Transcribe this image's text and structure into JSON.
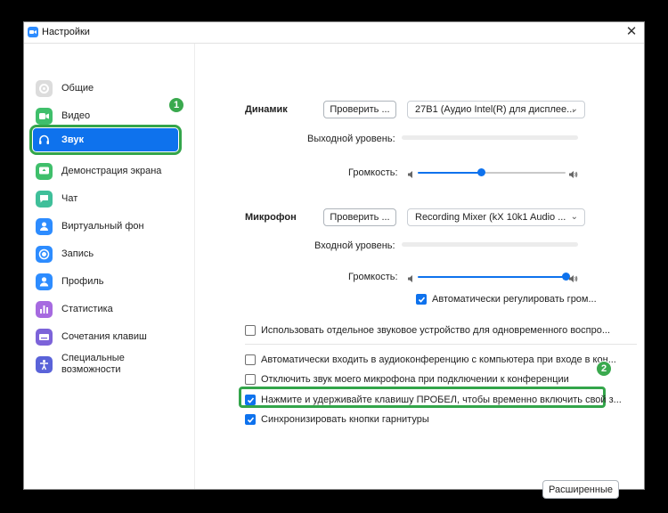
{
  "window": {
    "title": "Настройки",
    "close": "✕"
  },
  "sidebar": {
    "items": [
      {
        "label": "Общие",
        "icon": "gear-icon",
        "color": "#dcdcdc"
      },
      {
        "label": "Видео",
        "icon": "video-icon",
        "color": "#3fbf6b"
      },
      {
        "label": "Звук",
        "icon": "headphones-icon",
        "color": "#0e72ed",
        "active": true
      },
      {
        "label": "Демонстрация экрана",
        "icon": "share-screen-icon",
        "color": "#3fbf6b"
      },
      {
        "label": "Чат",
        "icon": "chat-icon",
        "color": "#3fbf9a"
      },
      {
        "label": "Виртуальный фон",
        "icon": "person-icon",
        "color": "#2d8cff"
      },
      {
        "label": "Запись",
        "icon": "record-icon",
        "color": "#2d8cff"
      },
      {
        "label": "Профиль",
        "icon": "profile-icon",
        "color": "#2d8cff"
      },
      {
        "label": "Статистика",
        "icon": "stats-icon",
        "color": "#a66ae0"
      },
      {
        "label": "Сочетания клавиш",
        "icon": "keyboard-icon",
        "color": "#7c63d9"
      },
      {
        "label": "Специальные\nвозможности",
        "icon": "accessibility-icon",
        "color": "#5a63d9"
      }
    ]
  },
  "badges": {
    "one": "1",
    "two": "2"
  },
  "speaker": {
    "label": "Динамик",
    "test_button": "Проверить ...",
    "device": "27B1 (Аудио Intel(R) для дисплее...",
    "output_level_label": "Выходной уровень:",
    "volume_label": "Громкость:",
    "volume_fraction": 0.43
  },
  "mic": {
    "label": "Микрофон",
    "test_button": "Проверить ...",
    "device": "Recording Mixer (kX 10k1 Audio ...",
    "input_level_label": "Входной уровень:",
    "volume_label": "Громкость:",
    "volume_fraction": 1.0,
    "auto_adjust": "Автоматически регулировать гром...",
    "auto_adjust_checked": true
  },
  "options": {
    "separate_device": {
      "label": "Использовать отдельное звуковое устройство для одновременного воспро...",
      "checked": false
    },
    "auto_join": {
      "label": "Автоматически входить в аудиоконференцию с компьютера при входе в кон...",
      "checked": false
    },
    "mute_mic": {
      "label": "Отключить звук моего микрофона при подключении к конференции",
      "checked": false
    },
    "push_to_talk": {
      "label": "Нажмите и удерживайте клавишу ПРОБЕЛ, чтобы временно включить свой з...",
      "checked": true
    },
    "sync_headset": {
      "label": "Синхронизировать кнопки гарнитуры",
      "checked": true
    }
  },
  "advanced_button": "Расширенные",
  "colors": {
    "accent": "#0e72ed",
    "highlight": "#33a54a"
  }
}
